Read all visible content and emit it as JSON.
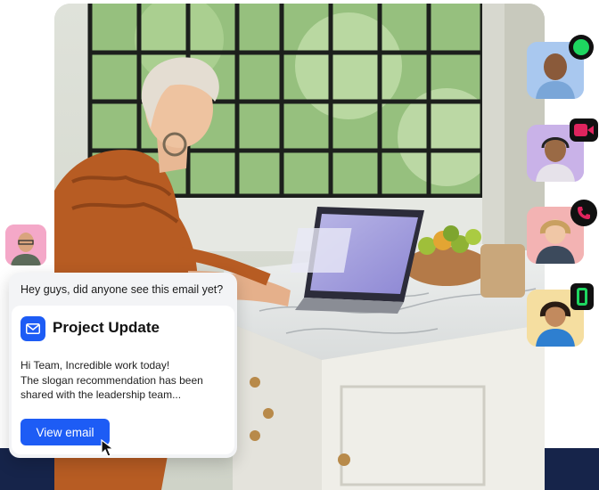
{
  "chat": {
    "message": "Hey guys, did anyone see this email yet?",
    "email": {
      "title": "Project Update",
      "body": [
        "Hi Team, Incredible work today!",
        "The slogan recommendation has been",
        "shared with the leadership team..."
      ],
      "button_label": "View email"
    }
  },
  "participants": [
    {
      "status": "online",
      "status_color": "#1ed760"
    },
    {
      "status": "video",
      "status_color": "#e0245e"
    },
    {
      "status": "phone",
      "status_color": "#e0245e"
    },
    {
      "status": "mobile",
      "status_color": "#1ed760"
    }
  ],
  "colors": {
    "accent": "#1d5cf5",
    "navy": "#16244a",
    "online_green": "#1ed760",
    "alert_pink": "#e0245e"
  },
  "icons": [
    "mail-icon",
    "cursor-icon",
    "online-dot-icon",
    "video-icon",
    "phone-icon",
    "mobile-icon"
  ]
}
